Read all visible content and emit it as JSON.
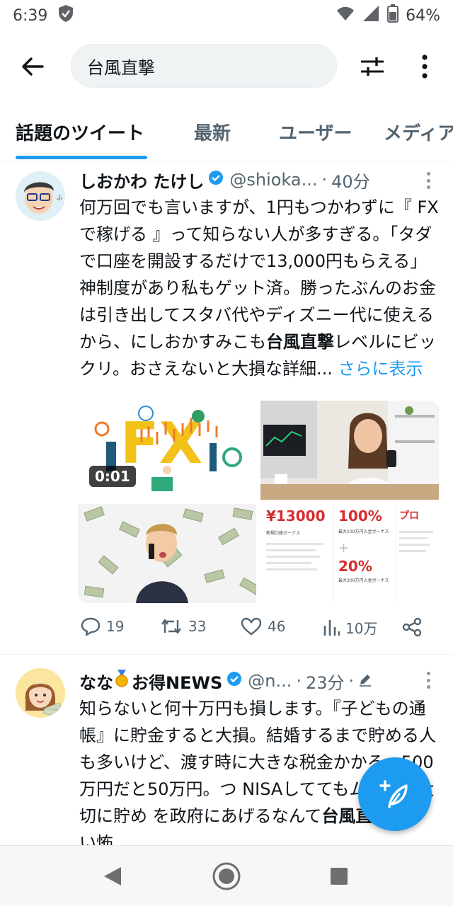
{
  "status_bar": {
    "time": "6:39",
    "battery": "64%"
  },
  "search": {
    "query": "台風直撃"
  },
  "tabs": [
    {
      "label": "話題のツイート",
      "active": true
    },
    {
      "label": "最新",
      "active": false
    },
    {
      "label": "ユーザー",
      "active": false
    },
    {
      "label": "メディア",
      "active": false
    }
  ],
  "tweets": [
    {
      "name": "しおかわ たけし",
      "handle": "@shioka...",
      "separator": "·",
      "time": "40分",
      "text_before": "何万回でも言いますが、1円もつかわずに『 FXで稼げる 』って知らない人が多すぎる。「タダで口座を開設するだけで13,000円もらえる」神制度があり私もゲット済。勝ったぶんのお金は引き出してスタバ代やディズニー代に使えるから、にしおかすみこも",
      "text_bold": "台風直撃",
      "text_after": "レベルにビックリ。おさえないと大損な詳細... ",
      "show_more": "さらに表示",
      "media": {
        "video_duration": "0:01",
        "promo": {
          "amount": "¥13000",
          "amount_caption": "新規口座ボーナス",
          "percent1": "100%",
          "percent1_caption": "最大100万円入金ボーナス",
          "plus": "+",
          "percent2": "20%",
          "percent2_caption": "最大300万円入金ボーナス",
          "third_title": "プロ"
        }
      },
      "stats": {
        "replies": "19",
        "retweets": "33",
        "likes": "46",
        "views": "10万"
      }
    },
    {
      "name": "なな",
      "name_suffix": "お得NEWS",
      "handle": "@n...",
      "separator": "·",
      "time": "23分",
      "separator2": "·",
      "text_before": "知らないと何十万円も損します。『子どもの通帳』に貯金すると大損。結婚するまで貯める人も多いけど、渡す時に大きな税金かかる。500万円だと50万円。つ NISAしててもムダに。大切に貯め を政府にあげるなんて",
      "text_bold": "台風直撃",
      "text_after": "くらい怖"
    }
  ],
  "colors": {
    "accent": "#1d9bf0",
    "text": "#0f1419",
    "secondary": "#536471"
  }
}
